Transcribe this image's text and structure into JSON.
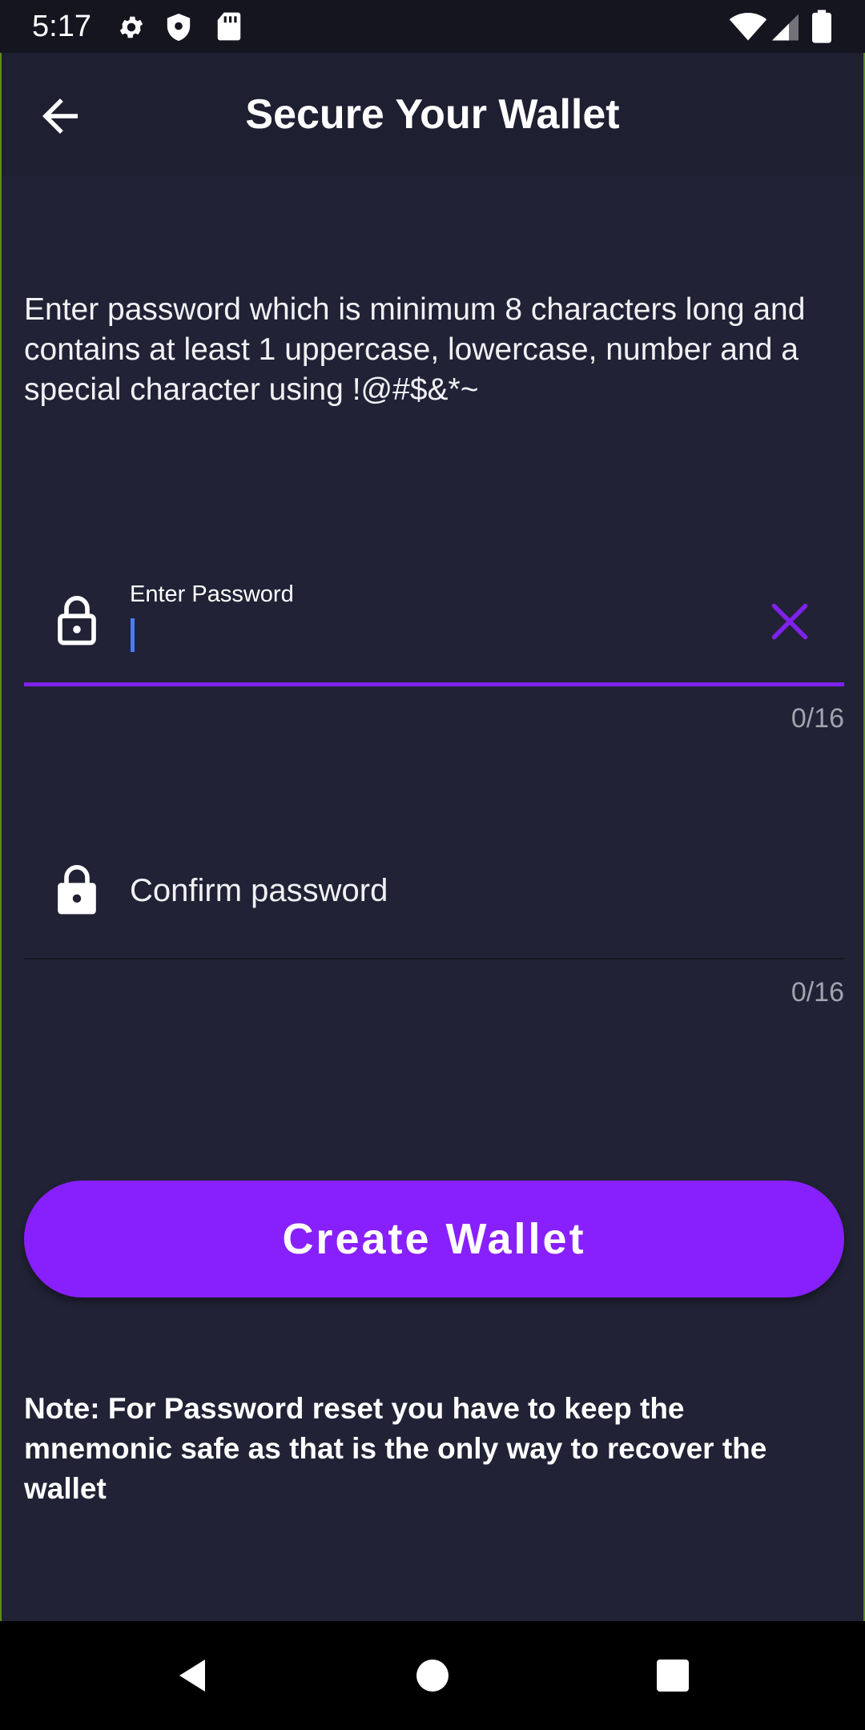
{
  "status_bar": {
    "time": "5:17"
  },
  "toolbar": {
    "title": "Secure Your Wallet"
  },
  "instructions": "Enter password which is minimum 8 characters long and contains at least 1 uppercase, lowercase, number and a special character using !@#$&*~",
  "password_field": {
    "label": "Enter Password",
    "value": "",
    "counter": "0/16"
  },
  "confirm_field": {
    "placeholder": "Confirm password",
    "value": "",
    "counter": "0/16"
  },
  "create_button": {
    "label": "Create Wallet"
  },
  "note": "Note: For Password reset you have to keep the mnemonic safe as that is the only way to recover the wallet",
  "colors": {
    "background": "#212235",
    "toolbar": "#1e1f31",
    "accent": "#8820fe",
    "underline_active": "#7f22ec",
    "cursor": "#4a7cf4",
    "counter_text": "#a2a3ad"
  },
  "icons": {
    "back": "arrow-left-icon",
    "lock": "lock-icon",
    "clear": "close-icon",
    "settings": "gear-icon",
    "shield": "shield-icon",
    "sd_card": "sd-card-icon",
    "wifi": "wifi-icon",
    "signal": "cellular-signal-icon",
    "battery": "battery-icon"
  }
}
